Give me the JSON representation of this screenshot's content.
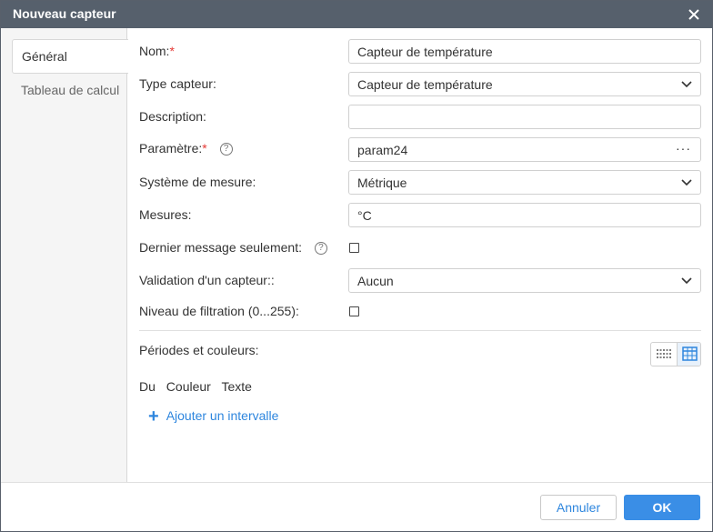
{
  "dialog": {
    "title": "Nouveau capteur"
  },
  "tabs": [
    {
      "label": "Général",
      "active": true
    },
    {
      "label": "Tableau de calcul",
      "active": false
    }
  ],
  "form": {
    "name": {
      "label": "Nom:",
      "required": "*",
      "value": "Capteur de température"
    },
    "type": {
      "label": "Type capteur:",
      "value": "Capteur de température"
    },
    "description": {
      "label": "Description:",
      "value": ""
    },
    "parameter": {
      "label": "Paramètre:",
      "required": "*",
      "help": "?",
      "value": "param24",
      "more": "···"
    },
    "measure_system": {
      "label": "Système de mesure:",
      "value": "Métrique"
    },
    "units": {
      "label": "Mesures:",
      "value": "°C"
    },
    "last_message_only": {
      "label": "Dernier message seulement:",
      "help": "?",
      "checked": false
    },
    "validation": {
      "label": "Validation d'un capteur::",
      "value": "Aucun"
    },
    "filtration": {
      "label": "Niveau de filtration (0...255):",
      "checked": false
    }
  },
  "periods": {
    "label": "Périodes et couleurs:",
    "columns": [
      "Du",
      "Couleur",
      "Texte"
    ],
    "add_label": "Ajouter un intervalle",
    "add_icon": "+"
  },
  "footer": {
    "cancel_label": "Annuler",
    "ok_label": "OK"
  },
  "colors": {
    "titlebar": "#56606c",
    "accent": "#3a8ee6",
    "required": "#e53935"
  }
}
